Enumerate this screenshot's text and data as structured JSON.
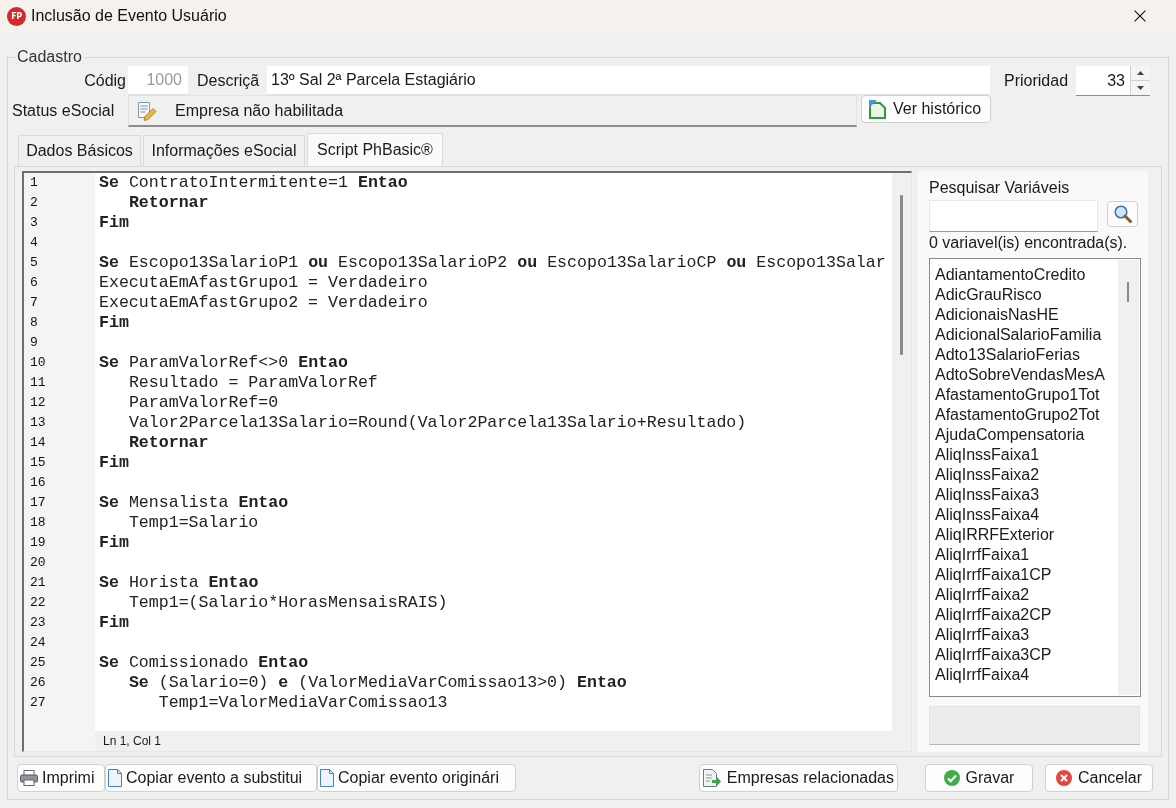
{
  "window": {
    "logo": "FP",
    "title": "Inclusão de Evento Usuário"
  },
  "group": {
    "title": "Cadastro"
  },
  "code_field": {
    "label": "Códig",
    "value": "1000",
    "disabled": true
  },
  "description_field": {
    "label": "Descriçã",
    "value": "13º Sal 2ª Parcela Estagiário"
  },
  "priority_field": {
    "label": "Prioridad",
    "value": "33"
  },
  "esocial_status": {
    "label": "Status eSocial",
    "value": "Empresa não habilitada"
  },
  "history_button": {
    "label": "Ver histórico"
  },
  "tabs": [
    {
      "label": "Dados Básicos",
      "selected": false
    },
    {
      "label": "Informações eSocial",
      "selected": false
    },
    {
      "label": "Script PhBasic®",
      "selected": true
    }
  ],
  "editor": {
    "lines": [
      {
        "number": "1",
        "text": "**Se** ContratoIntermitente=1 **Entao**"
      },
      {
        "number": "2",
        "text": "   **Retornar**"
      },
      {
        "number": "3",
        "text": "**Fim**"
      },
      {
        "number": "4"
      },
      {
        "number": "5",
        "text": "**Se** Escopo13SalarioP1 **ou** Escopo13SalarioP2 **ou** Escopo13SalarioCP **ou** Escopo13Salar"
      },
      {
        "number": "6",
        "text": "ExecutaEmAfastGrupo1 = Verdadeiro"
      },
      {
        "number": "7",
        "text": "ExecutaEmAfastGrupo2 = Verdadeiro"
      },
      {
        "number": "8",
        "text": "**Fim**"
      },
      {
        "number": "9"
      },
      {
        "number": "10",
        "text": "**Se** ParamValorRef<>0 **Entao**"
      },
      {
        "number": "11",
        "text": "   Resultado = ParamValorRef"
      },
      {
        "number": "12",
        "text": "   ParamValorRef=0"
      },
      {
        "number": "13",
        "text": "   Valor2Parcela13Salario=Round(Valor2Parcela13Salario+Resultado)"
      },
      {
        "number": "14",
        "text": "   **Retornar**"
      },
      {
        "number": "15",
        "text": "**Fim**"
      },
      {
        "number": "16"
      },
      {
        "number": "17",
        "text": "**Se** Mensalista **Entao**"
      },
      {
        "number": "18",
        "text": "   Temp1=Salario"
      },
      {
        "number": "19",
        "text": "**Fim**"
      },
      {
        "number": "20"
      },
      {
        "number": "21",
        "text": "**Se** Horista **Entao**"
      },
      {
        "number": "22",
        "text": "   Temp1=(Salario*HorasMensaisRAIS)"
      },
      {
        "number": "23",
        "text": "**Fim**"
      },
      {
        "number": "24"
      },
      {
        "number": "25",
        "text": "**Se** Comissionado **Entao**"
      },
      {
        "number": "26",
        "text": "   **Se** (Salario=0) **e** (ValorMediaVarComissao13>0) **Entao**"
      },
      {
        "number": "27",
        "text": "      Temp1=ValorMediaVarComissao13"
      }
    ],
    "status": "Ln 1, Col 1"
  },
  "variables": {
    "title": "Pesquisar Variáveis",
    "count": "0 variavel(is) encontrada(s).",
    "items": [
      {
        "label": "AdiantamentoCredito",
        "selected": false
      },
      {
        "label": "AdicGrauRisco",
        "selected": false
      },
      {
        "label": "AdicionaisNasHE",
        "selected": false
      },
      {
        "label": "AdicionalSalarioFamilia",
        "selected": false
      },
      {
        "label": "Adto13SalarioFerias",
        "selected": false
      },
      {
        "label": "AdtoSobreVendasMesA",
        "selected": false
      },
      {
        "label": "AfastamentoGrupo1Tot",
        "selected": false
      },
      {
        "label": "AfastamentoGrupo2Tot",
        "selected": false
      },
      {
        "label": "AjudaCompensatoria",
        "selected": false
      },
      {
        "label": "AliqInssFaixa1",
        "selected": false
      },
      {
        "label": "AliqInssFaixa2",
        "selected": false
      },
      {
        "label": "AliqInssFaixa3",
        "selected": false
      },
      {
        "label": "AliqInssFaixa4",
        "selected": false
      },
      {
        "label": "AliqIRRFExterior",
        "selected": false
      },
      {
        "label": "AliqIrrfFaixa1",
        "selected": false
      },
      {
        "label": "AliqIrrfFaixa1CP",
        "selected": false
      },
      {
        "label": "AliqIrrfFaixa2",
        "selected": false
      },
      {
        "label": "AliqIrrfFaixa2CP",
        "selected": false
      },
      {
        "label": "AliqIrrfFaixa3",
        "selected": false
      },
      {
        "label": "AliqIrrfFaixa3CP",
        "selected": false
      },
      {
        "label": "AliqIrrfFaixa4",
        "selected": false
      }
    ]
  },
  "left_buttons": [
    {
      "label": "Imprimi",
      "kind": "print"
    },
    {
      "label": "Copiar evento a substitui",
      "kind": "copy"
    },
    {
      "label": "Copiar evento originári",
      "kind": "copy"
    }
  ],
  "right_buttons": [
    {
      "label": "Empresas relacionadas",
      "kind": "companies"
    },
    {
      "label": "Gravar",
      "kind": "save"
    },
    {
      "label": "Cancelar",
      "kind": "cancel"
    }
  ]
}
